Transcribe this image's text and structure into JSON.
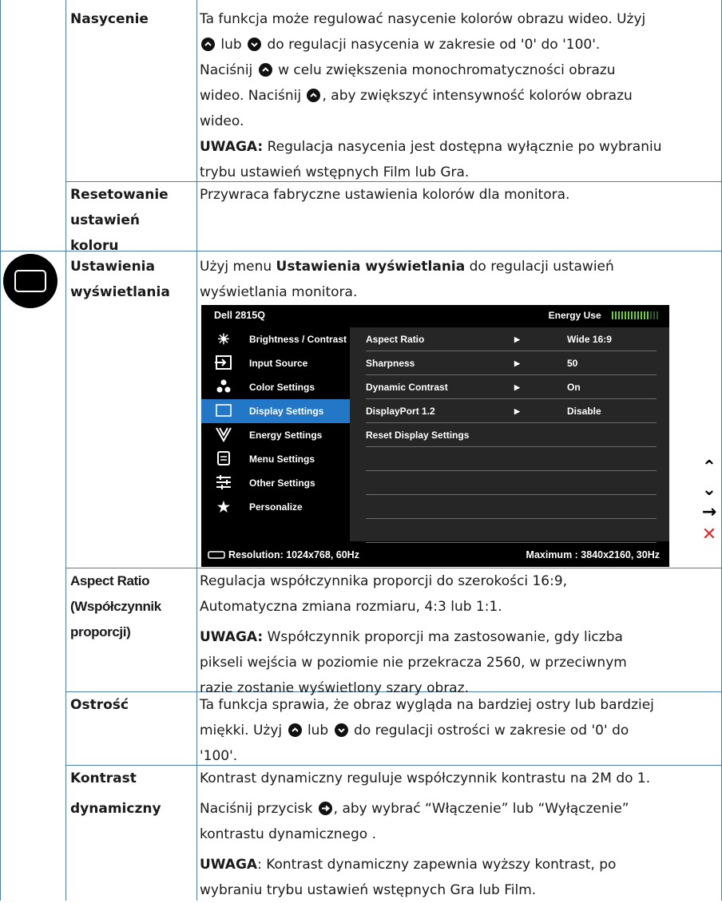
{
  "rows": {
    "nasycenie": {
      "name": "Nasycenie",
      "p1a": "Ta funkcja może regulować nasycenie kolorów obrazu wideo. Użyj",
      "p1b": "lub",
      "p1c": "do regulacji nasycenia w zakresie od '0' do '100'.",
      "p2a": "Naciśnij",
      "p2b": "w celu zwiększenia monochromatyczności obrazu",
      "p3a": "wideo. Naciśnij",
      "p3b": ", aby zwiększyć intensywność kolorów obrazu",
      "p4": "wideo.",
      "note_label": "UWAGA:",
      "note1": "Regulacja nasycenia jest dostępna wyłącznie po wybraniu",
      "note2": "trybu ustawień wstępnych Film lub Gra."
    },
    "reset": {
      "name1": "Resetowanie",
      "name2": "ustawień",
      "name3": "koloru",
      "desc": "Przywraca fabryczne ustawienia kolorów dla monitora."
    },
    "display": {
      "name1": "Ustawienia",
      "name2": "wyświetlania",
      "d1a": "Użyj menu",
      "d1b": "Ustawienia wyświetlania",
      "d1c": "do regulacji ustawień",
      "d2": "wyświetlania monitora."
    },
    "aspect": {
      "name1": "Aspect Ratio",
      "name2": "(Współczynnik",
      "name3": "proporcji)",
      "d1": "Regulacja współczynnika proporcji do szerokości 16:9,",
      "d2": "Automatyczna zmiana rozmiaru, 4:3 lub 1:1.",
      "note_label": "UWAGA:",
      "n1": "Współczynnik proporcji ma zastosowanie, gdy liczba",
      "n2": "pikseli wejścia w poziomie nie przekracza 2560, w przeciwnym",
      "n3": "razie zostanie wyświetlony szary obraz."
    },
    "ostrosc": {
      "name": "Ostrość",
      "d1": "Ta funkcja sprawia, że obraz wygląda na bardziej ostry lub bardziej",
      "d2a": "miękki. Użyj",
      "d2b": "lub",
      "d2c": "do regulacji ostrości w zakresie od '0' do",
      "d3": "'100'."
    },
    "kontrast": {
      "name1": "Kontrast",
      "name2": "dynamiczny",
      "d1": "Kontrast dynamiczny reguluje współczynnik kontrastu na 2M do 1.",
      "d2a": "Naciśnij przycisk",
      "d2b": ", aby wybrać “Włączenie” lub “Wyłączenie”",
      "d3": "kontrastu dynamicznego .",
      "note_label": "UWAGA",
      "n1": ": Kontrast dynamiczny zapewnia wyższy kontrast, po",
      "n2": "wybraniu trybu ustawień wstępnych Gra lub Film."
    }
  },
  "osd": {
    "model": "Dell 2815Q",
    "energy_label": "Energy Use",
    "energy_level": 0.8,
    "menu": [
      {
        "icon": "brightness-icon",
        "label": "Brightness / Contrast"
      },
      {
        "icon": "input-source-icon",
        "label": "Input Source"
      },
      {
        "icon": "color-settings-icon",
        "label": "Color Settings"
      },
      {
        "icon": "display-settings-icon",
        "label": "Display Settings"
      },
      {
        "icon": "energy-settings-icon",
        "label": "Energy Settings"
      },
      {
        "icon": "menu-settings-icon",
        "label": "Menu Settings"
      },
      {
        "icon": "other-settings-icon",
        "label": "Other Settings"
      },
      {
        "icon": "personalize-icon",
        "label": "Personalize"
      }
    ],
    "selected_index": 3,
    "items": [
      {
        "label": "Aspect Ratio",
        "value": "Wide 16:9"
      },
      {
        "label": "Sharpness",
        "value": "50"
      },
      {
        "label": "Dynamic Contrast",
        "value": "On"
      },
      {
        "label": "DisplayPort 1.2",
        "value": "Disable"
      },
      {
        "label": "Reset Display Settings",
        "value": ""
      }
    ],
    "resolution": "Resolution: 1024x768,  60Hz",
    "maximum": "Maximum : 3840x2160,  30Hz",
    "accent": "#2278c6"
  }
}
